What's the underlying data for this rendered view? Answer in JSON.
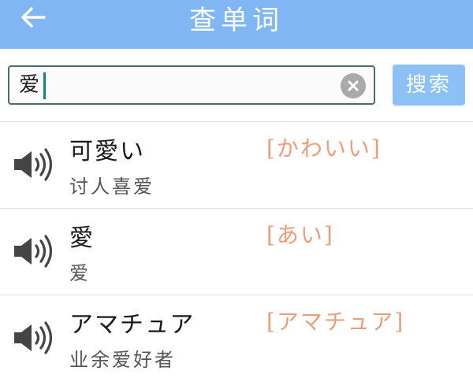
{
  "header": {
    "title": "查单词",
    "back_icon": "arrow-left-icon",
    "bg_color": "#7fb6f3"
  },
  "search": {
    "value": "爱",
    "clear_icon": "clear-circle-x-icon",
    "button_label": "搜索"
  },
  "results": [
    {
      "word": "可愛い",
      "reading": "[かわいい]",
      "meaning": "讨人喜爱",
      "icon": "speaker-icon"
    },
    {
      "word": "愛",
      "reading": "[あい]",
      "meaning": "爱",
      "icon": "speaker-icon"
    },
    {
      "word": "アマチュア",
      "reading": "[アマチュア]",
      "meaning": "业余爱好者",
      "icon": "speaker-icon"
    }
  ],
  "colors": {
    "reading": "#e8a07c",
    "caret": "#0d8a73",
    "search_button": "#8dc0f5"
  }
}
